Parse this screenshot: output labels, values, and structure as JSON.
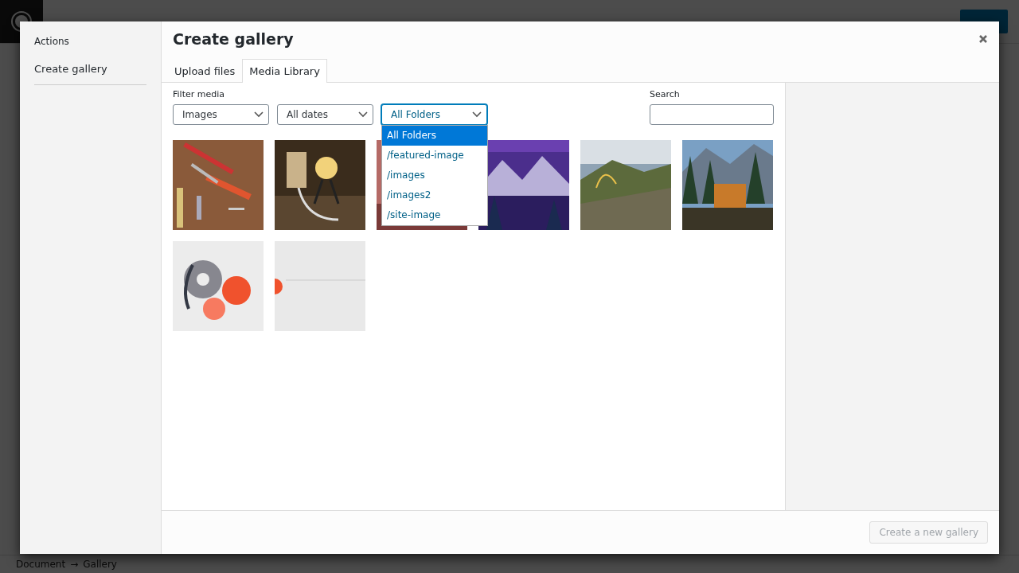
{
  "modal": {
    "menu": {
      "heading": "Actions",
      "items": [
        "Create gallery"
      ]
    },
    "title": "Create gallery",
    "tabs": [
      {
        "label": "Upload files",
        "selected": false
      },
      {
        "label": "Media Library",
        "selected": true
      }
    ],
    "filters": {
      "label": "Filter media",
      "selects": [
        {
          "value": "Images",
          "open": false
        },
        {
          "value": "All dates",
          "open": false
        },
        {
          "value": "All Folders",
          "open": true
        }
      ]
    },
    "folder_options": [
      {
        "label": "All Folders",
        "selected": true
      },
      {
        "label": "/featured-image",
        "selected": false
      },
      {
        "label": "/images",
        "selected": false
      },
      {
        "label": "/images2",
        "selected": false
      },
      {
        "label": "/site-image",
        "selected": false
      }
    ],
    "search": {
      "label": "Search"
    },
    "footer": {
      "button": {
        "label": "Create a new gallery",
        "disabled": true
      }
    }
  },
  "status_bar": {
    "breadcrumbs": [
      "Document",
      "→",
      "Gallery"
    ]
  }
}
